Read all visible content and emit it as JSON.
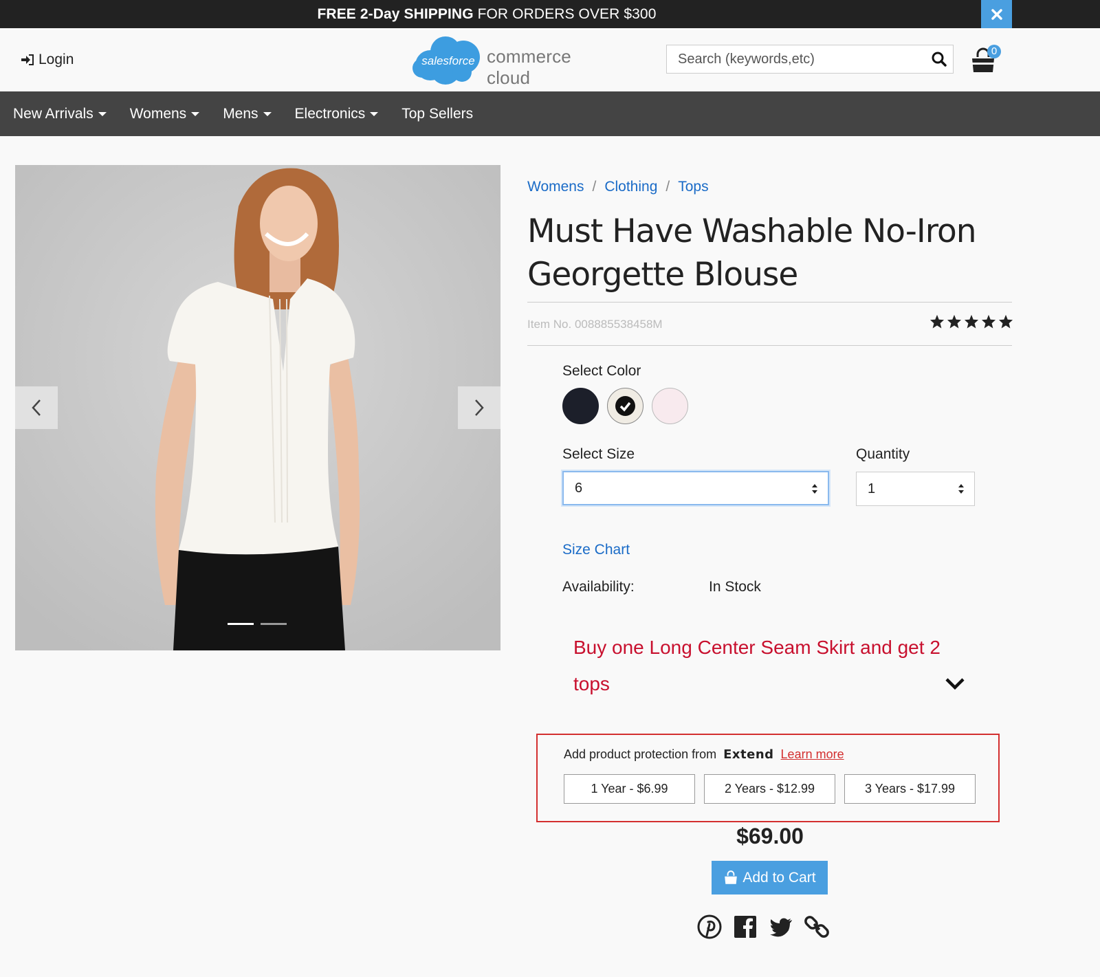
{
  "promo": {
    "bold": "FREE 2-Day SHIPPING",
    "rest": " FOR ORDERS OVER $300"
  },
  "header": {
    "login_label": "Login",
    "logo_badge": "salesforce",
    "logo_text": "commerce cloud",
    "search_placeholder": "Search (keywords,etc)",
    "cart_count": "0"
  },
  "nav": {
    "items": [
      "New Arrivals",
      "Womens",
      "Mens",
      "Electronics",
      "Top Sellers"
    ]
  },
  "breadcrumb": [
    "Womens",
    "Clothing",
    "Tops"
  ],
  "product": {
    "title": "Must Have Washable No-Iron Georgette Blouse",
    "item_no": "Item No. 008885538458M",
    "rating": 5,
    "select_color_label": "Select Color",
    "colors": [
      "#1c1f2a",
      "#f0ece4",
      "#f8eaee"
    ],
    "selected_color_index": 1,
    "select_size_label": "Select Size",
    "size_value": "6",
    "quantity_label": "Quantity",
    "quantity_value": "1",
    "size_chart_label": "Size Chart",
    "availability_label": "Availability:",
    "availability_value": "In Stock",
    "promotion": "Buy one Long Center Seam Skirt and get 2 tops",
    "price": "$69.00",
    "add_to_cart": "Add to Cart"
  },
  "extend": {
    "intro": "Add product protection from",
    "brand": "Extend",
    "learn_more": "Learn more",
    "plans": [
      "1 Year - $6.99",
      "2 Years - $12.99",
      "3 Years - $17.99"
    ]
  },
  "gallery": {
    "slide_count": 2,
    "active_slide": 0
  },
  "colors": {
    "accent": "#4a9fe0",
    "link": "#1a6bc7",
    "promo_red": "#c8102e",
    "nav_bg": "#444444"
  },
  "icons": [
    "close-icon",
    "login-icon",
    "search-icon",
    "cart-icon",
    "chevron-left-icon",
    "chevron-right-icon",
    "star-icon",
    "check-icon",
    "chevron-down-icon",
    "pinterest-icon",
    "facebook-icon",
    "twitter-icon",
    "link-icon"
  ]
}
